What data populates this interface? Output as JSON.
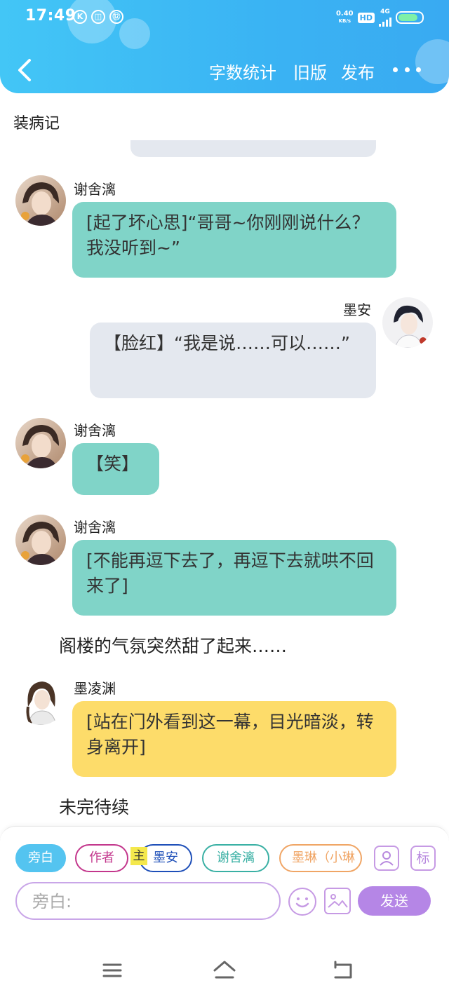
{
  "status_bar": {
    "time": "17:49",
    "left_icons": [
      "K",
      "◫",
      "⑫"
    ],
    "speed_value": "0.40",
    "speed_unit": "KB/s",
    "hd": "HD",
    "network": "4G"
  },
  "nav": {
    "actions": [
      "字数统计",
      "旧版",
      "发布"
    ]
  },
  "doc_title": "装病记",
  "messages": [
    {
      "speaker": "谢舍漓",
      "text": "[起了坏心思]“哥哥~你刚刚说什么？我没听到~”"
    },
    {
      "speaker": "墨安",
      "text": "【脸红】“我是说……可以……”"
    },
    {
      "speaker": "谢舍漓",
      "text": "【笑】"
    },
    {
      "speaker": "谢舍漓",
      "text": "[不能再逗下去了，再逗下去就哄不回来了]"
    },
    {
      "narration": "阁楼的气氛突然甜了起来……"
    },
    {
      "speaker": "墨凌渊",
      "text": "[站在门外看到这一幕，目光暗淡，转身离开]"
    },
    {
      "narration": "未完待续"
    }
  ],
  "composer": {
    "roles": [
      "旁白",
      "作者",
      "墨安",
      "谢舍漓",
      "墨琳（小琳"
    ],
    "main_badge": "主",
    "tag_button": "标",
    "placeholder": "旁白:",
    "send_label": "发送"
  },
  "colors": {
    "header": "#3ab3f3",
    "teal_bubble": "#80d4c8",
    "grey_bubble": "#e4e8ef",
    "yellow_bubble": "#fddc6a",
    "send": "#b586e6"
  },
  "icons": {
    "back": "chevron-left-icon",
    "more": "more-dots-icon",
    "profile": "user-profile-icon",
    "emoji": "smiley-icon",
    "image": "image-icon",
    "menu": "menu-icon",
    "home": "home-icon",
    "back_sys": "return-icon"
  }
}
